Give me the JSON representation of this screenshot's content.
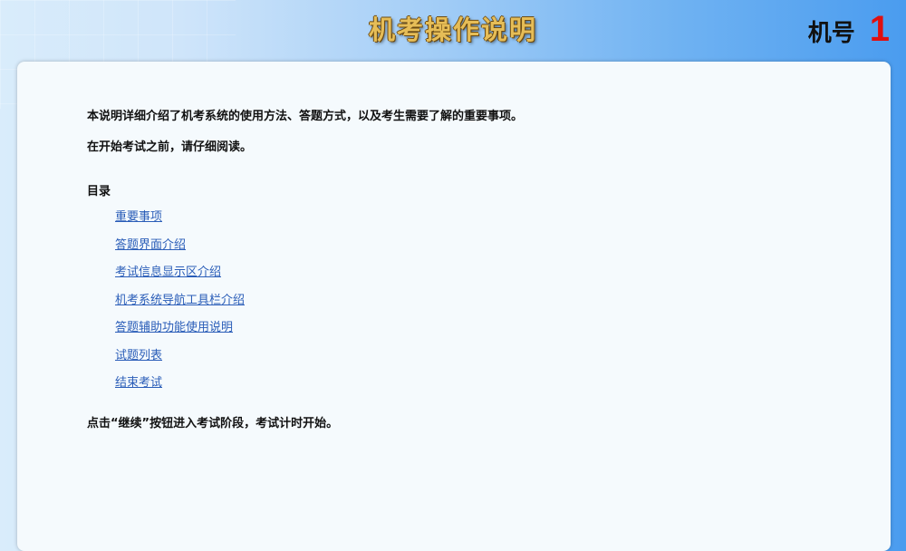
{
  "header": {
    "title": "机考操作说明",
    "machine_label": "机号",
    "machine_number": "1"
  },
  "intro": {
    "line1": "本说明详细介绍了机考系统的使用方法、答题方式，以及考生需要了解的重要事项。",
    "line2": "在开始考试之前，请仔细阅读。"
  },
  "toc": {
    "title": "目录",
    "items": [
      {
        "label": "重要事项"
      },
      {
        "label": "答题界面介绍"
      },
      {
        "label": "考试信息显示区介绍"
      },
      {
        "label": "机考系统导航工具栏介绍"
      },
      {
        "label": "答题辅助功能使用说明"
      },
      {
        "label": "试题列表"
      },
      {
        "label": "结束考试"
      }
    ]
  },
  "footer": {
    "instruction": "点击“继续”按钮进入考试阶段，考试计时开始。"
  },
  "colors": {
    "title_gold": "#e6bd57",
    "machine_number_red": "#e01010",
    "link_blue": "#2a5db8",
    "panel_bg": "#f5fafd"
  }
}
